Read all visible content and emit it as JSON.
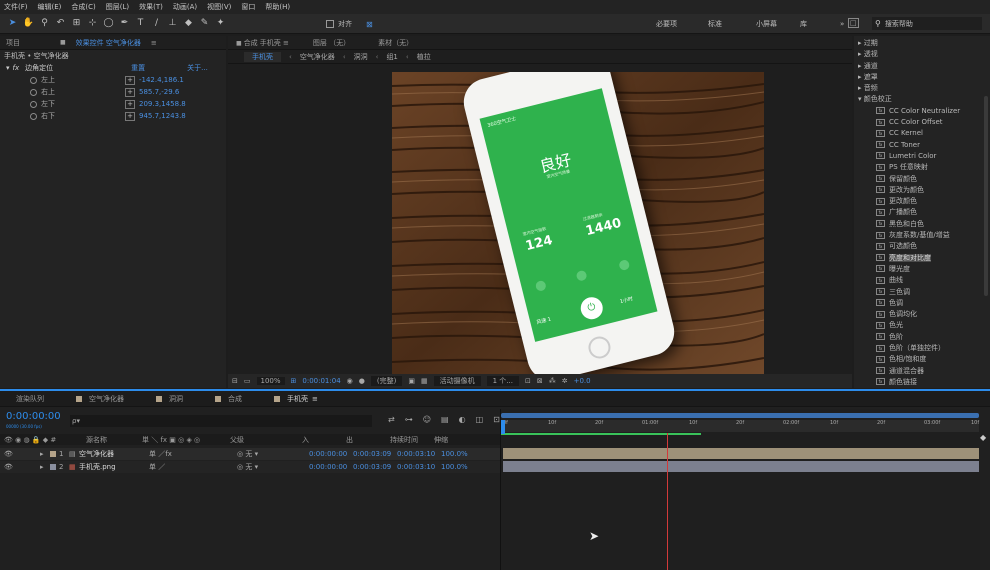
{
  "menu": [
    "文件(F)",
    "编辑(E)",
    "合成(C)",
    "图层(L)",
    "效果(T)",
    "动画(A)",
    "视图(V)",
    "窗口",
    "帮助(H)"
  ],
  "toolbar": {
    "snap_label": "对齐",
    "workspaces": [
      "必要项",
      "标准",
      "小屏幕",
      "库"
    ],
    "search_placeholder": "搜索帮助"
  },
  "project_panel": {
    "tab_project": "项目",
    "tab_effects": "效果控件 空气净化器",
    "menu_icon": "≡",
    "breadcrumb": "手机壳 • 空气净化器"
  },
  "effect": {
    "name": "边角定位",
    "col_reset": "重置",
    "col_about": "关于...",
    "fx": "fx",
    "params": [
      {
        "name": "左上",
        "value": "-142.4,186.1"
      },
      {
        "name": "右上",
        "value": "585.7,-29.6"
      },
      {
        "name": "左下",
        "value": "209.3,1458.8"
      },
      {
        "name": "右下",
        "value": "945.7,1243.8"
      }
    ]
  },
  "comp_panel": {
    "tab_comp": "合成 手机壳",
    "tab_layer": "图层 （无）",
    "tab_footage": "素材（无）",
    "flow": [
      "手机壳",
      "空气净化器",
      "洞洞",
      "组1",
      "植拉"
    ]
  },
  "phone": {
    "app_title": "360空气卫士",
    "status": "良好",
    "sub": "室内空气质量",
    "stat1_label": "室内空气指数",
    "stat1_value": "124",
    "stat2_label": "过滤器剩余",
    "stat2_value": "1440",
    "bottom_left": "风速 1",
    "bottom_right": "1小时"
  },
  "viewer": {
    "zoom": "100%",
    "timecode": "0:00:01:04",
    "quality": "(完整)",
    "camera": "活动摄像机",
    "views": "1 个...",
    "exposure": "+0.0"
  },
  "effects_panel": {
    "categories": [
      "过期",
      "透视",
      "通道",
      "遮罩",
      "音频",
      "颜色校正"
    ],
    "items": [
      "CC Color Neutralizer",
      "CC Color Offset",
      "CC Kernel",
      "CC Toner",
      "Lumetri Color",
      "PS 任意映射",
      "保留颜色",
      "更改为颜色",
      "更改颜色",
      "广播颜色",
      "黑色和白色",
      "灰度系数/基值/增益",
      "可选颜色",
      "亮度和对比度",
      "曝光度",
      "曲线",
      "三色调",
      "色调",
      "色调均化",
      "色光",
      "色阶",
      "色阶（单独控件）",
      "色相/饱和度",
      "通道混合器",
      "颜色链接"
    ]
  },
  "timeline": {
    "tabs": [
      "渲染队列",
      "空气净化器",
      "洞洞",
      "合成",
      "手机壳"
    ],
    "active_tab": "手机壳",
    "timecode": "0:00:00:00",
    "timecode_sub": "00000 (30.00 fps)",
    "search_placeholder": "ρ▾",
    "col_source": "源名称",
    "col_parent": "父级",
    "col_in": "入",
    "col_out": "出",
    "col_duration": "持续时间",
    "col_stretch": "伸缩",
    "ruler": [
      "0f",
      "10f",
      "20f",
      "01:00f",
      "10f",
      "20f",
      "02:00f",
      "10f",
      "20f",
      "03:00f",
      "10f",
      "20f",
      "04:0"
    ],
    "layers": [
      {
        "num": "1",
        "name": "空气净化器",
        "parent": "无",
        "in": "0:00:00:00",
        "out": "0:00:03:09",
        "dur": "0:00:03:10",
        "stretch": "100.0%"
      },
      {
        "num": "2",
        "name": "手机壳.png",
        "parent": "无",
        "in": "0:00:00:00",
        "out": "0:00:03:09",
        "dur": "0:00:03:10",
        "stretch": "100.0%"
      }
    ]
  },
  "colors": {
    "accent": "#2d8ceb",
    "phone_green": "#2fb24d",
    "label_tan": "#b5a48a",
    "label_gray": "#8a8f9f",
    "playhead": "#d23a3a"
  }
}
